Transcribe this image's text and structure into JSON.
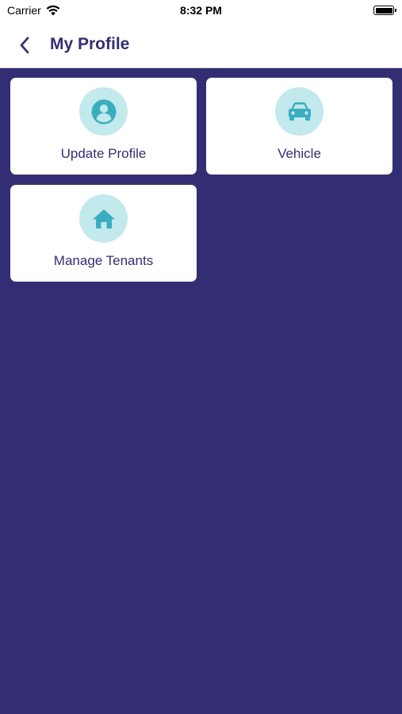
{
  "status_bar": {
    "carrier": "Carrier",
    "time": "8:32 PM",
    "battery_level": 1.0
  },
  "header": {
    "title": "My Profile",
    "back_icon": "chevron-left-icon"
  },
  "tiles": [
    {
      "label": "Update Profile",
      "icon": "user-circle-icon"
    },
    {
      "label": "Vehicle",
      "icon": "car-icon"
    },
    {
      "label": "Manage Tenants",
      "icon": "house-icon"
    }
  ],
  "colors": {
    "background": "#332e74",
    "accent": "#3aaec0",
    "icon_bg": "#c2e9ec",
    "text": "#332e74"
  }
}
